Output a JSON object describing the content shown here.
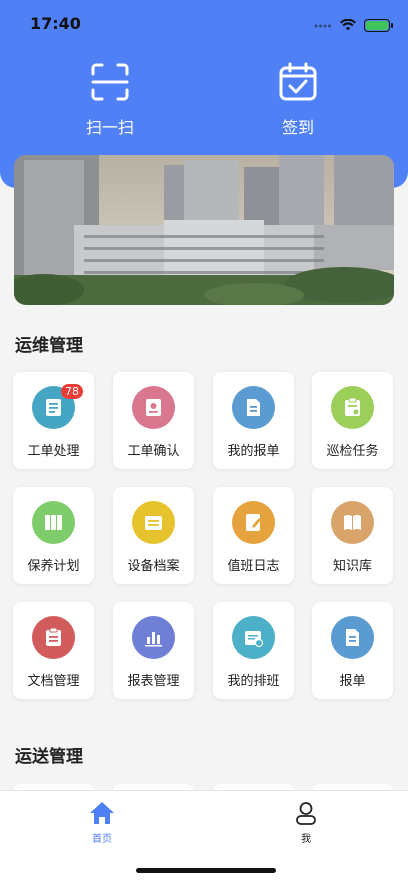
{
  "status_bar": {
    "time": "17:40"
  },
  "quick_actions": {
    "scan_label": "扫一扫",
    "sign_label": "签到"
  },
  "sections": [
    {
      "title": "运维管理",
      "items": [
        {
          "label": "工单处理",
          "badge": "78",
          "color": "#45a6c4",
          "icon": "work-order-icon"
        },
        {
          "label": "工单确认",
          "color": "#d9778f",
          "icon": "order-confirm-icon"
        },
        {
          "label": "我的报单",
          "color": "#5a9bd1",
          "icon": "my-report-icon"
        },
        {
          "label": "巡检任务",
          "color": "#9bcf5a",
          "icon": "inspection-icon"
        },
        {
          "label": "保养计划",
          "color": "#7fcc6a",
          "icon": "maintenance-icon"
        },
        {
          "label": "设备档案",
          "color": "#e6c22d",
          "icon": "equipment-file-icon"
        },
        {
          "label": "值班日志",
          "color": "#e5a23d",
          "icon": "duty-log-icon"
        },
        {
          "label": "知识库",
          "color": "#d9a46a",
          "icon": "knowledge-base-icon"
        },
        {
          "label": "文档管理",
          "color": "#d25b5b",
          "icon": "document-icon"
        },
        {
          "label": "报表管理",
          "color": "#6f7fd6",
          "icon": "report-chart-icon"
        },
        {
          "label": "我的排班",
          "color": "#4db0c9",
          "icon": "schedule-icon"
        },
        {
          "label": "报单",
          "color": "#5a9bd1",
          "icon": "report-doc-icon"
        }
      ]
    },
    {
      "title": "运送管理"
    }
  ],
  "tab_bar": {
    "home_label": "首页",
    "me_label": "我",
    "active_color": "#4f80f5"
  }
}
